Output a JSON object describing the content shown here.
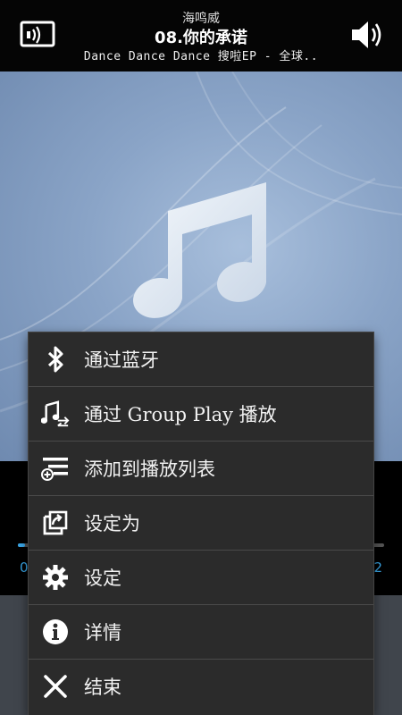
{
  "header": {
    "artist": "海鸣威",
    "title": "08.你的承诺",
    "album": "Dance Dance Dance 搜啦EP - 全球.."
  },
  "player": {
    "progress": 0.0,
    "time_left_partial": "0",
    "time_right_partial": "2"
  },
  "menu": {
    "items": [
      {
        "label": "通过蓝牙",
        "icon": "bluetooth-icon"
      },
      {
        "label": "通过 Group Play 播放",
        "icon": "group-play-icon"
      },
      {
        "label": "添加到播放列表",
        "icon": "add-to-playlist-icon"
      },
      {
        "label": "设定为",
        "icon": "set-as-icon"
      },
      {
        "label": "设定",
        "icon": "gear-icon"
      },
      {
        "label": "详情",
        "icon": "info-icon"
      },
      {
        "label": "结束",
        "icon": "close-icon"
      }
    ]
  },
  "colors": {
    "accent": "#3aa7e8",
    "menu_bg": "#2b2b2b",
    "art_bg": "#8aa4c7"
  }
}
